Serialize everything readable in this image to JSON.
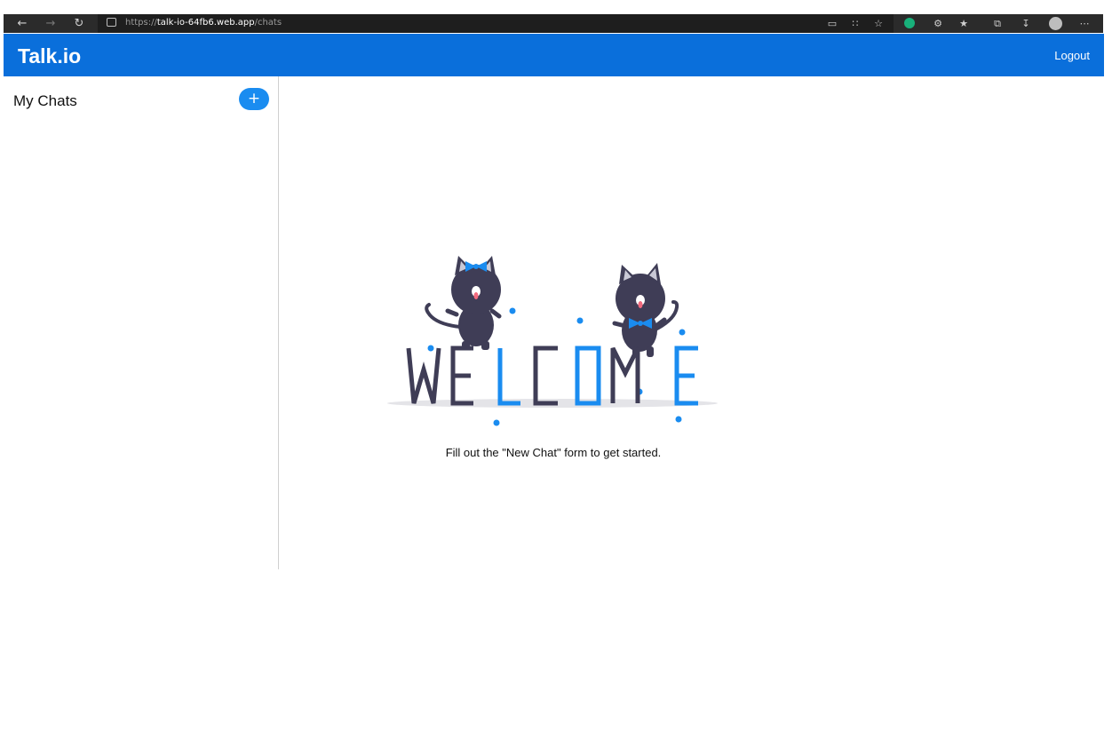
{
  "browser": {
    "url_scheme": "https://",
    "url_host": "talk-io-64fb6.web.app",
    "url_path": "/chats",
    "icons": [
      "back-icon",
      "forward-icon",
      "reload-icon",
      "lock-icon",
      "reader-icon",
      "apps-icon",
      "favorite-add-icon",
      "extension-icon",
      "extensions-icon",
      "favorites-icon",
      "collections-icon",
      "downloads-icon",
      "profile-icon",
      "more-icon"
    ]
  },
  "header": {
    "brand": "Talk.io",
    "logout_label": "Logout",
    "color": "#0a6fdb"
  },
  "sidebar": {
    "title": "My Chats",
    "add_label": "+",
    "accent": "#1a8cf0"
  },
  "main": {
    "welcome_word": "WELCOME",
    "caption": "Fill out the \"New Chat\" form to get started."
  }
}
